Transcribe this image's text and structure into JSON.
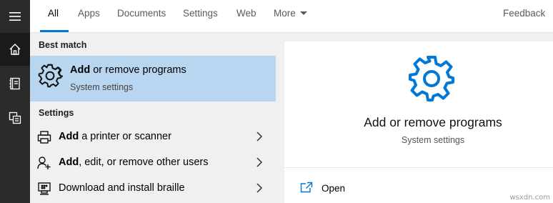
{
  "tabs": [
    {
      "label": "All",
      "active": true
    },
    {
      "label": "Apps"
    },
    {
      "label": "Documents"
    },
    {
      "label": "Settings"
    },
    {
      "label": "Web"
    },
    {
      "label": "More"
    }
  ],
  "feedback_label": "Feedback",
  "rail": {
    "items": [
      {
        "icon": "hamburger-menu-icon"
      },
      {
        "icon": "home-icon",
        "active": true
      },
      {
        "icon": "notebook-icon"
      },
      {
        "icon": "documents-icon"
      }
    ]
  },
  "results": {
    "best_match_heading": "Best match",
    "best_match": {
      "title_bold": "Add",
      "title_rest": " or remove programs",
      "subtitle": "System settings",
      "icon": "gear-icon"
    },
    "settings_heading": "Settings",
    "settings_items": [
      {
        "bold": "Add",
        "rest": " a printer or scanner",
        "icon": "printer-icon"
      },
      {
        "bold": "Add",
        "rest": ", edit, or remove other users",
        "icon": "user-add-icon"
      },
      {
        "bold": "",
        "rest": "Download and install braille",
        "icon": "braille-display-icon"
      }
    ]
  },
  "preview": {
    "title": "Add or remove programs",
    "subtitle": "System settings",
    "icon": "gear-icon",
    "open_label": "Open",
    "open_icon": "open-icon"
  },
  "watermark": "wsxdn.com",
  "colors": {
    "accent": "#0078d7",
    "selection": "#b9d6f1",
    "rail": "#2b2b2b"
  }
}
